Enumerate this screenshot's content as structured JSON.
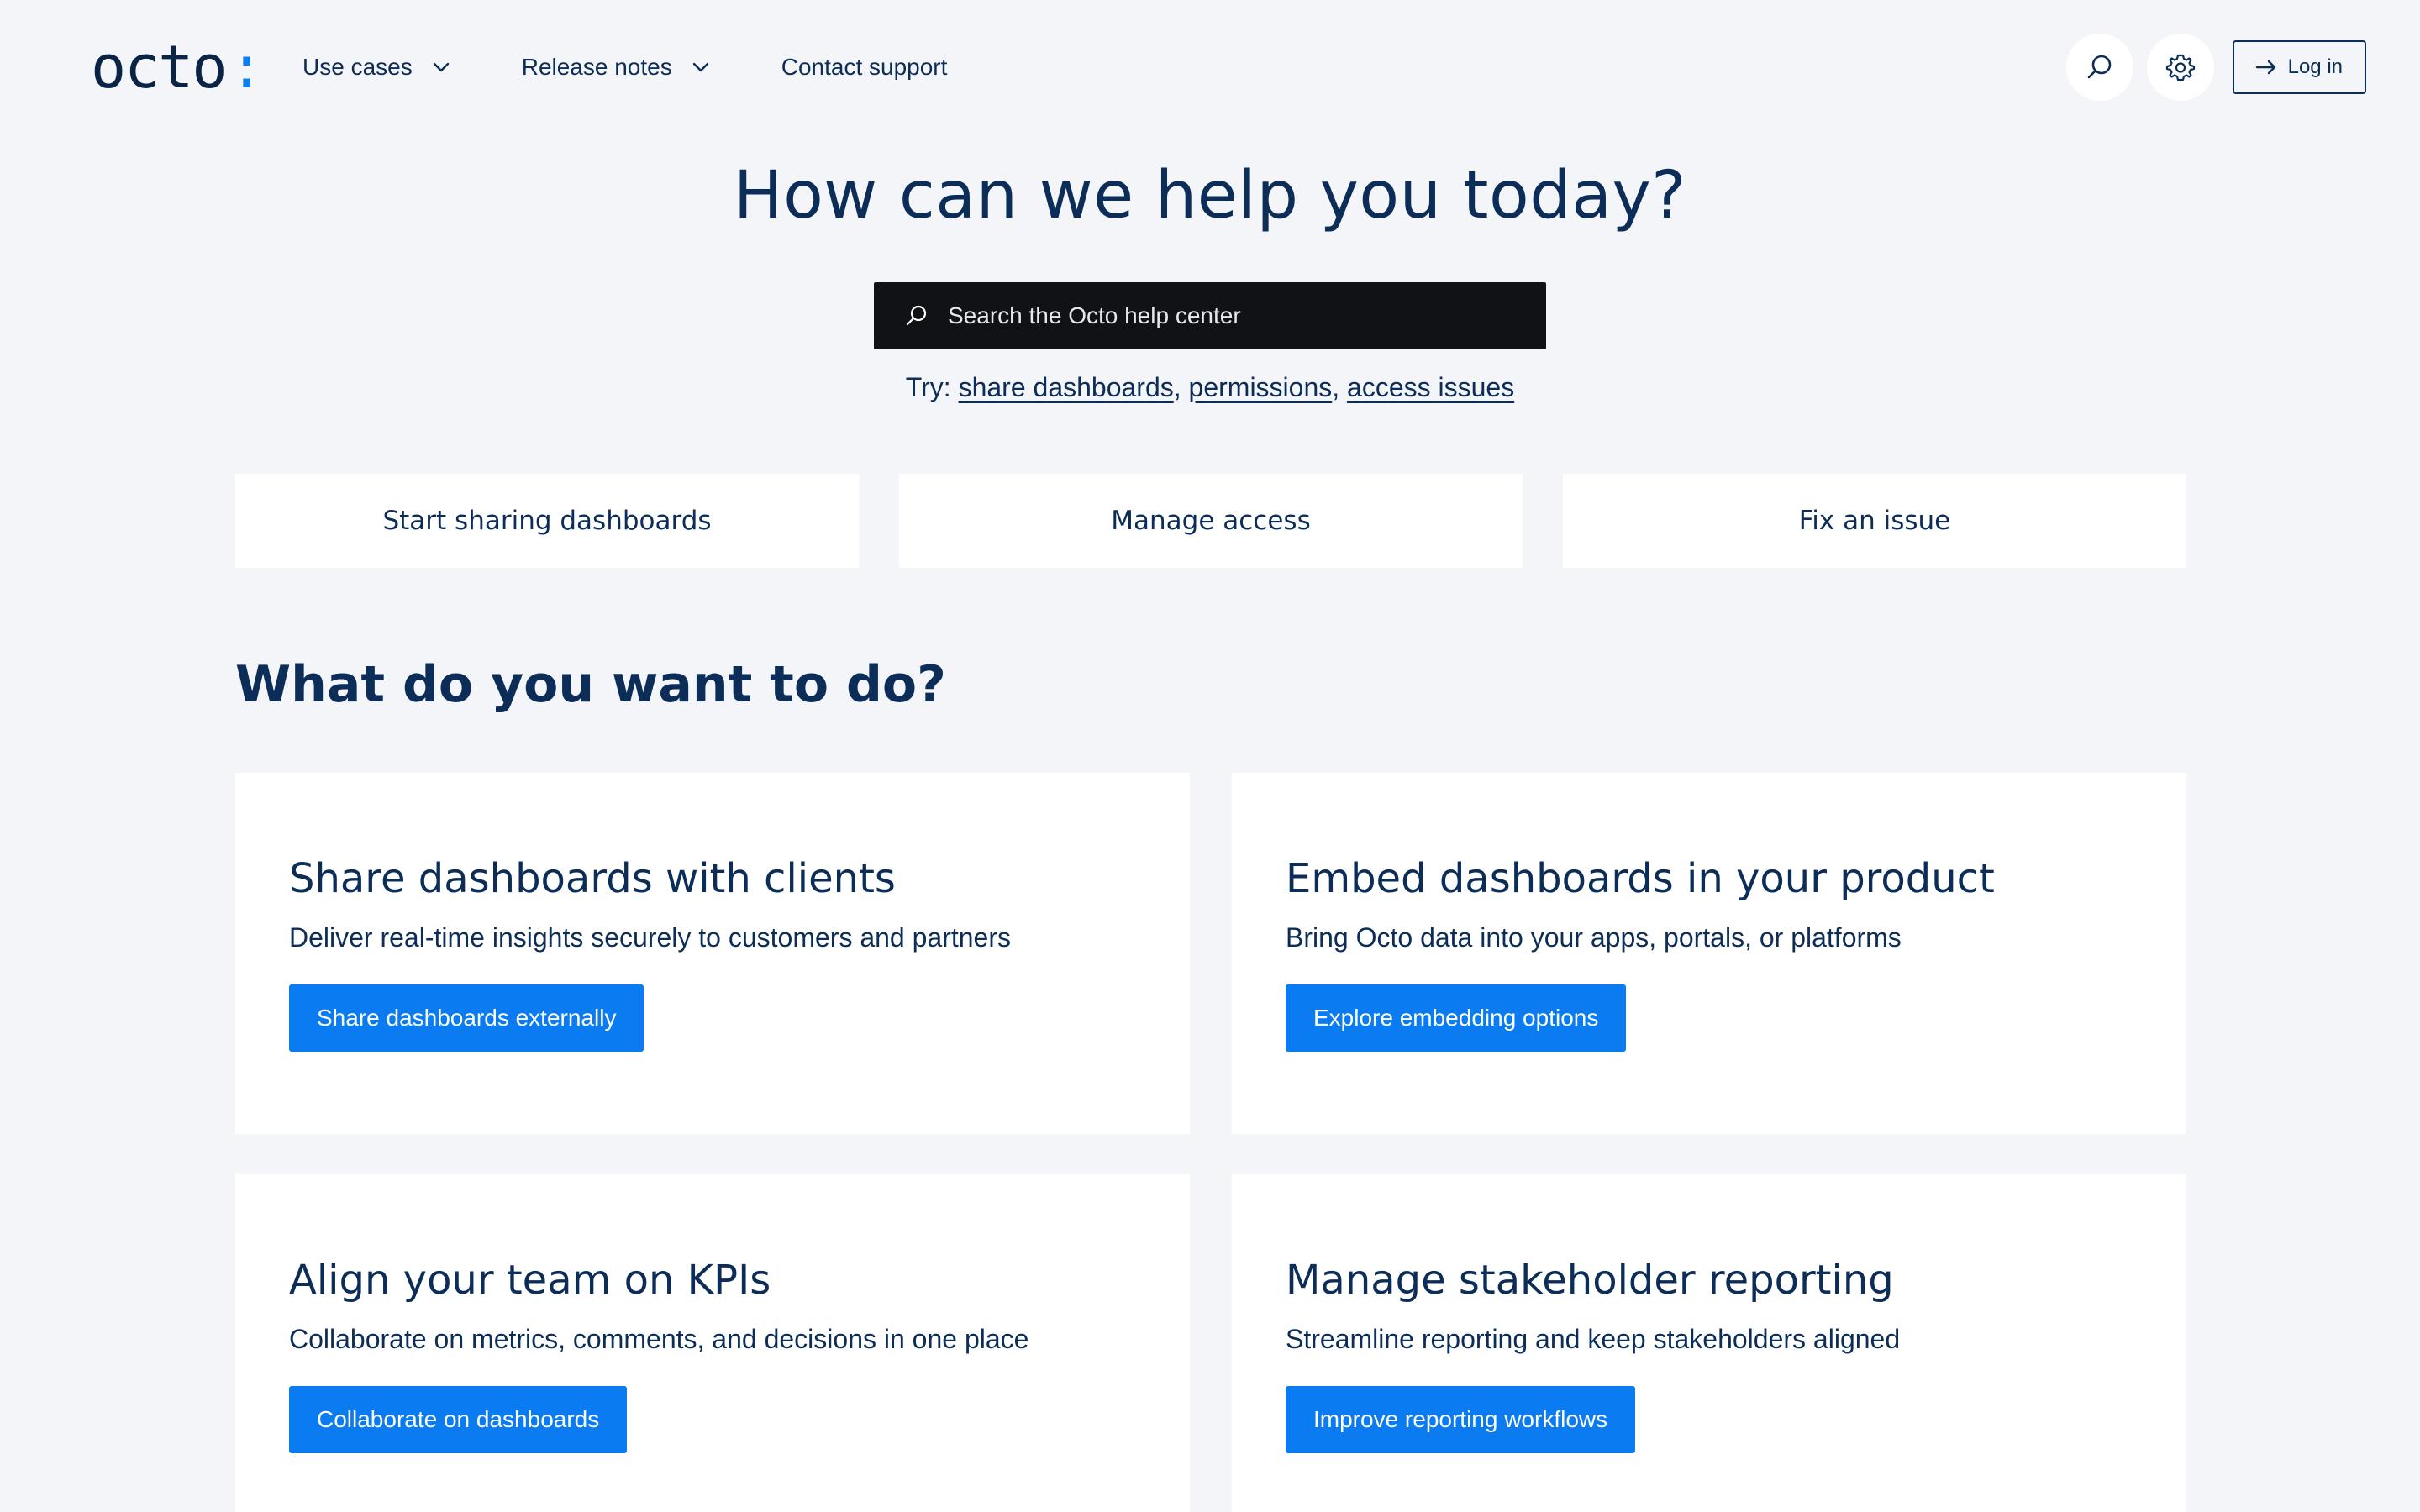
{
  "brand": {
    "name": "octo",
    "suffix": ":",
    "accent": "#0f7ef0"
  },
  "nav": {
    "use_cases": "Use cases",
    "release_notes": "Release notes",
    "contact_support": "Contact support"
  },
  "header": {
    "search_icon": "search-icon",
    "settings_icon": "gear-icon",
    "login_label": "Log in"
  },
  "hero": {
    "title": "How can we help you today?",
    "search_placeholder": "Search the Octo help center",
    "try_prefix": "Try:",
    "suggestions": [
      "share dashboards",
      "permissions",
      "access issues"
    ],
    "separator": ","
  },
  "quick_links": [
    "Start sharing dashboards",
    "Manage access",
    "Fix an issue"
  ],
  "section": {
    "title": "What do you want to do?",
    "cards": [
      {
        "title": "Share dashboards with clients",
        "description": "Deliver real-time insights securely to customers and partners",
        "button": "Share dashboards externally"
      },
      {
        "title": "Embed dashboards in your product",
        "description": "Bring Octo data into your apps, portals, or platforms",
        "button": "Explore embedding options"
      },
      {
        "title": "Align your team on KPIs",
        "description": "Collaborate on metrics, comments, and decisions in one place",
        "button": "Collaborate on dashboards"
      },
      {
        "title": "Manage stakeholder reporting",
        "description": "Streamline reporting and keep stakeholders aligned",
        "button": "Improve reporting workflows"
      }
    ]
  },
  "colors": {
    "background": "#f4f5f8",
    "text": "#0c2d57",
    "button": "#0b7bf1",
    "search_bg": "#111216"
  }
}
